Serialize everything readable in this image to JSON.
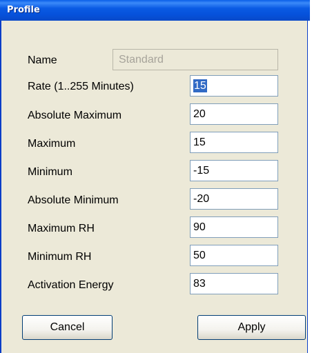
{
  "window": {
    "title": "Profile"
  },
  "name_row": {
    "label": "Name",
    "value": "Standard"
  },
  "fields": [
    {
      "label": "Rate (1..255 Minutes)",
      "value": "15"
    },
    {
      "label": "Absolute Maximum",
      "value": "20"
    },
    {
      "label": "Maximum",
      "value": "15"
    },
    {
      "label": "Minimum",
      "value": "-15"
    },
    {
      "label": "Absolute Minimum",
      "value": "-20"
    },
    {
      "label": "Maximum RH",
      "value": "90"
    },
    {
      "label": "Minimum RH",
      "value": "50"
    },
    {
      "label": "Activation Energy",
      "value": "83"
    }
  ],
  "buttons": {
    "cancel": "Cancel",
    "apply": "Apply"
  },
  "colors": {
    "titlebar": "#0a5be4",
    "window_bg": "#ece9d8",
    "selection": "#316ac5"
  }
}
